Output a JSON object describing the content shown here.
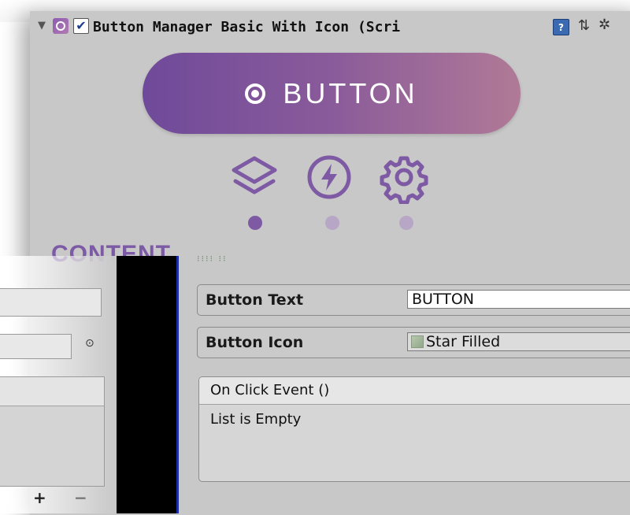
{
  "component": {
    "title": "Button Manager Basic With Icon (Scri",
    "enabled": true
  },
  "preview": {
    "button_label": "BUTTON"
  },
  "tabs": [
    {
      "icon": "layers-icon",
      "color": "#7d5aa3",
      "active": true
    },
    {
      "icon": "lightning-icon",
      "color": "#7d5aa3",
      "active": false
    },
    {
      "icon": "gear-icon",
      "color": "#7d5aa3",
      "active": false
    }
  ],
  "colors": {
    "accent": "#7c5aa6",
    "dot_active": "#7d5aa3",
    "dot_inactive": "#b7a6c6"
  },
  "content": {
    "heading": "CONTENT",
    "fields": [
      {
        "label": "Button Text",
        "value": "BUTTON"
      },
      {
        "label": "Button Icon",
        "value": "Star Filled"
      }
    ],
    "event": {
      "header": "On Click Event ()",
      "empty_text": "List is Empty"
    }
  },
  "left_panel": {
    "picker_glyph": "⊙",
    "add_label": "+",
    "remove_label": "−"
  }
}
